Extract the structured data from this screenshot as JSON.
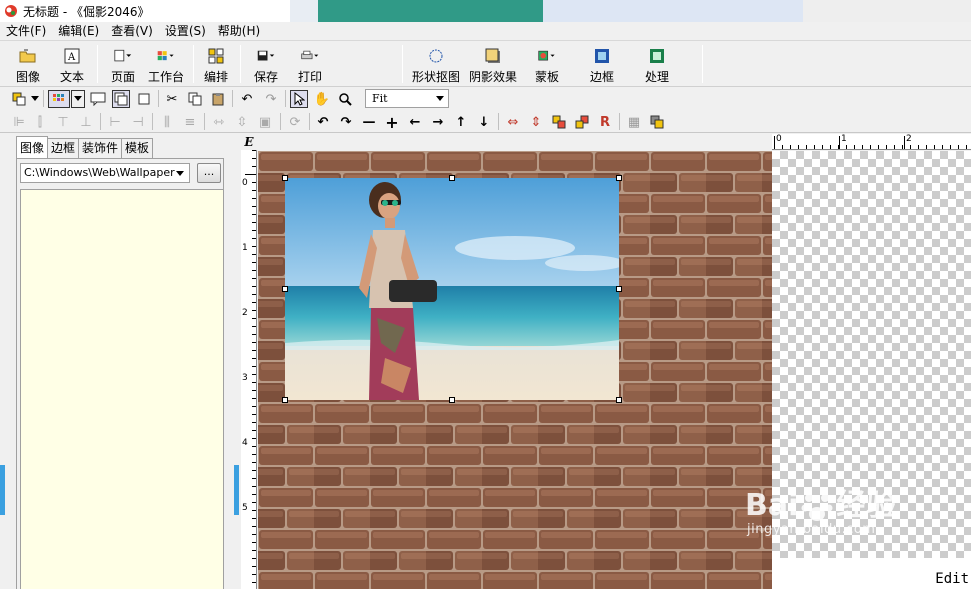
{
  "window": {
    "title": "无标题 - 《倔影2046》"
  },
  "menu": [
    "文件(F)",
    "编辑(E)",
    "查看(V)",
    "设置(S)",
    "帮助(H)"
  ],
  "toolbar_main": {
    "image": "图像",
    "text": "文本",
    "page": "页面",
    "workbench": "工作台",
    "arrange": "编排",
    "save": "保存",
    "print": "打印",
    "shape_cutout": "形状抠图",
    "shadow": "阴影效果",
    "mask": "蒙板",
    "border": "边框",
    "process": "处理"
  },
  "zoom": {
    "value": "Fit"
  },
  "left_panel": {
    "tabs": [
      "图像",
      "边框",
      "装饰件",
      "模板"
    ],
    "active_tab": 0,
    "path": "C:\\Windows\\Web\\Wallpaper",
    "browse_label": "..."
  },
  "rulers": {
    "corner_label": "E",
    "vertical_numbers": [
      "0",
      "1",
      "2",
      "3",
      "4",
      "5"
    ],
    "horizontal_numbers": [
      "0",
      "1",
      "2"
    ]
  },
  "status": {
    "mode_label": "Edit"
  },
  "watermark": {
    "brand": "Bai",
    "brand2": "经验",
    "url": "jingyan.baidu.com"
  },
  "colors": {
    "brick": "#8a5a44",
    "mortar": "#b89a86",
    "accent_handle": "#3ba0e0",
    "thumb_bg": "#ffffe6"
  }
}
